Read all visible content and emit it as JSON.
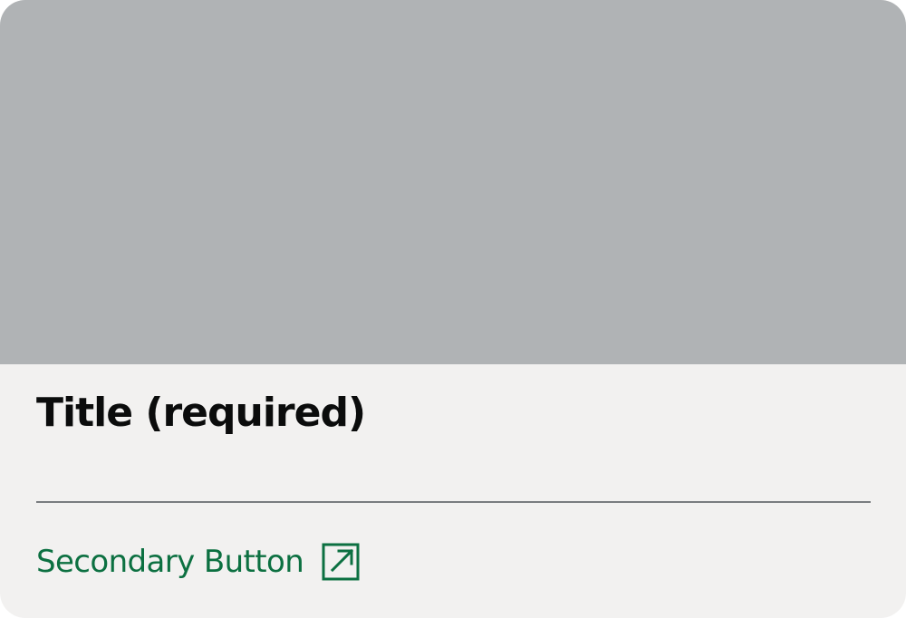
{
  "card": {
    "title": "Title (required)",
    "secondary_button": {
      "label": "Secondary Button",
      "icon": "external-link-icon"
    }
  },
  "colors": {
    "media_placeholder": "#b0b3b5",
    "card_background": "#f2f1f0",
    "title_text": "#0b0c0c",
    "divider": "#797c80",
    "link_green": "#0c7041"
  }
}
